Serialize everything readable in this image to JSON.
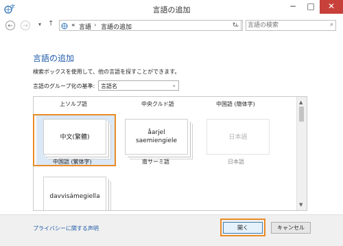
{
  "window": {
    "title": "言語の追加",
    "minimize": "−",
    "maximize": "□",
    "close": "✕"
  },
  "nav": {
    "back": "←",
    "forward": "→",
    "recent": "▾",
    "up": "↑",
    "breadcrumb_overflow": "«",
    "breadcrumb": [
      "言語",
      "言語の追加"
    ],
    "separator": "›",
    "address_dropdown": "⌄",
    "refresh": "↻",
    "search_placeholder": "言語の検索"
  },
  "main": {
    "heading": "言語の追加",
    "description": "検索ボックスを使用して、他の言語を探すことができます。",
    "group_label": "言語のグループ化の基準:",
    "group_value": "言語名"
  },
  "list": {
    "headers": [
      "上ソルブ語",
      "中央クルド語",
      "中国語 (簡体字)"
    ],
    "items": [
      {
        "tile": "中文(繁體)",
        "label": "中国語 (繁体字)"
      },
      {
        "tile_line1": "åarjel",
        "tile_line2": "saemiengiele",
        "label": "南サーミ語"
      },
      {
        "tile": "日本語",
        "label": "日本語"
      },
      {
        "tile": "davvisámegiella"
      }
    ]
  },
  "footer": {
    "privacy": "プライバシーに関する声明",
    "open": "開く",
    "cancel": "キャンセル"
  },
  "colors": {
    "highlight": "#ea8a25",
    "link": "#1e5aa8",
    "close": "#c7403a",
    "selection": "#dbe8f6"
  }
}
